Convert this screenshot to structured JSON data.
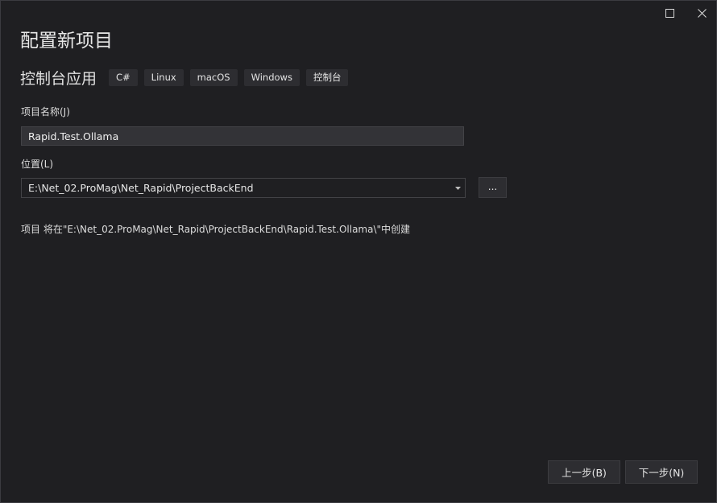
{
  "window": {
    "maximize_icon": "maximize-icon",
    "close_icon": "close-icon"
  },
  "page": {
    "title": "配置新项目"
  },
  "template": {
    "name": "控制台应用",
    "tags": [
      "C#",
      "Linux",
      "macOS",
      "Windows",
      "控制台"
    ]
  },
  "project_name": {
    "label": "项目名称(J)",
    "value": "Rapid.Test.Ollama"
  },
  "location": {
    "label": "位置(L)",
    "value": "E:\\Net_02.ProMag\\Net_Rapid\\ProjectBackEnd",
    "browse_label": "..."
  },
  "info": {
    "text": "项目 将在\"E:\\Net_02.ProMag\\Net_Rapid\\ProjectBackEnd\\Rapid.Test.Ollama\\\"中创建"
  },
  "footer": {
    "back_label": "上一步(B)",
    "next_label": "下一步(N)"
  },
  "colors": {
    "background": "#1f1f22",
    "control": "#2d2d31",
    "input": "#333337",
    "border": "#434347"
  }
}
